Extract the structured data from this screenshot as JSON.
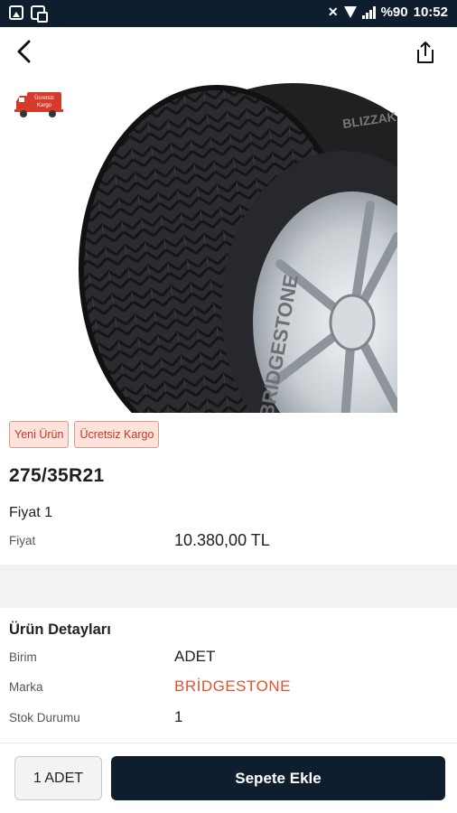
{
  "statusbar": {
    "battery": "%90",
    "time": "10:52"
  },
  "icons": {
    "back": "back-arrow-icon",
    "share": "share-icon",
    "cargo": "free-shipping-truck-icon"
  },
  "cargo_badge": {
    "line1": "Ücretsiz",
    "line2": "Kargo"
  },
  "tags": [
    "Yeni Ürün",
    "Ücretsiz Kargo"
  ],
  "product": {
    "title": "275/35R21",
    "image_text": {
      "brand": "BRIDGESTONE",
      "model": "BLIZZAK"
    }
  },
  "price_section": {
    "title": "Fiyat 1",
    "label": "Fiyat",
    "value": "10.380,00 TL"
  },
  "details": {
    "title": "Ürün Detayları",
    "rows": [
      {
        "label": "Birim",
        "value": "ADET"
      },
      {
        "label": "Marka",
        "value": "BRİDGESTONE"
      },
      {
        "label": "Stok Durumu",
        "value": "1"
      }
    ]
  },
  "bottom": {
    "qty_label": "1 ADET",
    "add_label": "Sepete Ekle"
  },
  "colors": {
    "dark": "#0f1e2e",
    "brand_accent": "#e1532e",
    "tag_bg": "#fde3dc"
  }
}
